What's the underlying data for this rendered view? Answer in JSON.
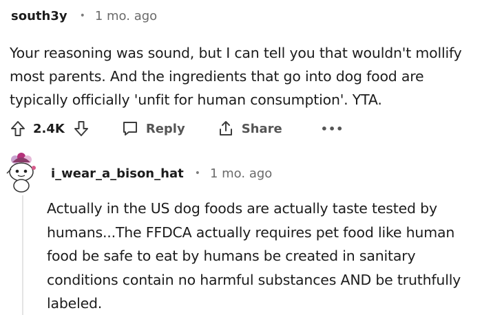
{
  "comment1": {
    "username": "south3y",
    "separator": "•",
    "time": "1 mo. ago",
    "body_lines": [
      "Your reasoning was sound, but I can tell you that wouldn't mollify",
      "most parents. And the ingredients that go into dog food are",
      "typically officially 'unfit for human consumption'. YTA."
    ],
    "actions": {
      "upvote_icon": "arrow-up-icon",
      "vote_count": "2.4K",
      "downvote_icon": "arrow-down-icon",
      "reply_icon": "chat-bubble-icon",
      "reply_label": "Reply",
      "share_icon": "share-icon",
      "share_label": "Share",
      "more_label": "•••"
    }
  },
  "comment2": {
    "avatar_icon": "snoo-avatar-icon",
    "username": "i_wear_a_bison_hat",
    "separator": "•",
    "time": "1 mo. ago",
    "body_lines": [
      "Actually in the US dog foods are actually taste tested by",
      "humans...The FFDCA actually requires pet food like human",
      "food be safe to eat by humans be created in sanitary",
      "conditions contain no harmful substances AND be truthfully",
      "labeled."
    ]
  }
}
